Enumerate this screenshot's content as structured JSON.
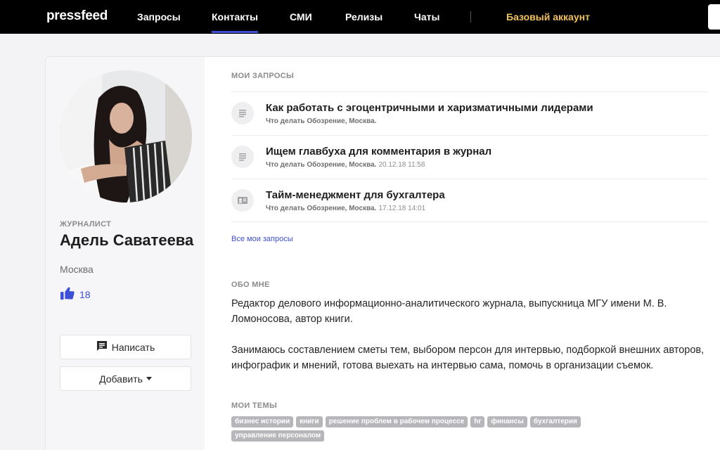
{
  "nav": {
    "logo": "pressfeed",
    "items": [
      {
        "label": "Запросы",
        "active": false
      },
      {
        "label": "Контакты",
        "active": true
      },
      {
        "label": "СМИ",
        "active": false
      },
      {
        "label": "Релизы",
        "active": false
      },
      {
        "label": "Чаты",
        "active": false
      }
    ],
    "account": "Базовый аккаунт"
  },
  "profile": {
    "role": "ЖУРНАЛИСТ",
    "name": "Адель Саватеева",
    "city": "Москва",
    "likes": "18",
    "write_label": "Написать",
    "add_label": "Добавить"
  },
  "requests": {
    "title": "МОИ ЗАПРОСЫ",
    "items": [
      {
        "title": "Как работать с эгоцентричными и харизматичными лидерами",
        "source": "Что делать Обозрение, Москва.",
        "date": "",
        "icon": "document-icon"
      },
      {
        "title": "Ищем главбуха для комментария в журнал",
        "source": "Что делать Обозрение, Москва.",
        "date": "20.12.18 11:58",
        "icon": "document-icon"
      },
      {
        "title": "Тайм-менеджмент для бухгалтера",
        "source": "Что делать Обозрение, Москва.",
        "date": "17.12.18 14:01",
        "icon": "contact-card-icon"
      }
    ],
    "all_link": "Все мои запросы"
  },
  "about": {
    "title": "ОБО МНЕ",
    "p1": "Редактор делового информационно-аналитического журнала, выпускница МГУ имени М. В. Ломоносова, автор книги.",
    "p2": "Занимаюсь составлением сметы тем, выбором персон для интервью, подборкой внешних авторов, инфографик и мнений, готова выехать на интервью сама, помочь в организации съемок."
  },
  "topics": {
    "title": "МОИ ТЕМЫ",
    "tags": [
      "бизнес истории",
      "книги",
      "решение проблем в рабочем процессе",
      "hr",
      "финансы",
      "бухгалтерия",
      "управление персоналом"
    ]
  },
  "colors": {
    "nav_bg": "#000000",
    "accent": "#3d4fd6",
    "account": "#f1c25b",
    "tag_bg": "#b6b6bb"
  }
}
